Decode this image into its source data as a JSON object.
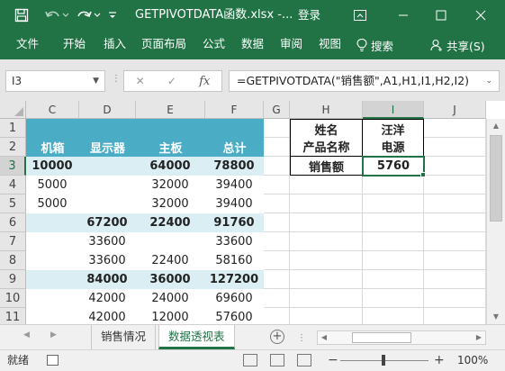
{
  "window": {
    "title": "GETPIVOTDATA函数.xlsx  -...",
    "login": "登录",
    "theme_color": "#217346"
  },
  "ribbon": {
    "tabs": [
      "文件",
      "开始",
      "插入",
      "页面布局",
      "公式",
      "数据",
      "审阅",
      "视图"
    ],
    "search": "搜索",
    "share": "共享(S)"
  },
  "formula_bar": {
    "name_box": "I3",
    "formula": "=GETPIVOTDATA(\"销售额\",A1,H1,I1,H2,I2)"
  },
  "columns": [
    "C",
    "D",
    "E",
    "F",
    "G",
    "H",
    "I",
    "J"
  ],
  "active_column": "I",
  "rows": [
    "1",
    "2",
    "3",
    "4",
    "5",
    "6",
    "7",
    "8",
    "9",
    "10"
  ],
  "active_row": "3",
  "pivot": {
    "header_row": [
      "机箱",
      "显示器",
      "主板",
      "总计"
    ],
    "header_color": "#4bacc6",
    "subtotal_color": "#daeef3",
    "data": [
      {
        "row": "3",
        "subtotal": true,
        "values": [
          "10000",
          "",
          "64000",
          "78800"
        ]
      },
      {
        "row": "4",
        "subtotal": false,
        "values": [
          "5000",
          "",
          "32000",
          "39400"
        ]
      },
      {
        "row": "5",
        "subtotal": false,
        "values": [
          "5000",
          "",
          "32000",
          "39400"
        ]
      },
      {
        "row": "6",
        "subtotal": true,
        "values": [
          "",
          "67200",
          "22400",
          "91760"
        ]
      },
      {
        "row": "7",
        "subtotal": false,
        "values": [
          "",
          "33600",
          "",
          "33600"
        ]
      },
      {
        "row": "8",
        "subtotal": false,
        "values": [
          "",
          "33600",
          "22400",
          "58160"
        ]
      },
      {
        "row": "9",
        "subtotal": true,
        "values": [
          "",
          "84000",
          "36000",
          "127200"
        ]
      },
      {
        "row": "10",
        "subtotal": false,
        "values": [
          "",
          "42000",
          "24000",
          "69600"
        ]
      },
      {
        "row": "11",
        "subtotal": false,
        "values": [
          "",
          "42000",
          "12000",
          "57600"
        ]
      }
    ]
  },
  "lookup_table": {
    "H1": "姓名",
    "I1": "汪洋",
    "H2": "产品名称",
    "I2": "电源",
    "H3": "销售额",
    "I3": "5760"
  },
  "sheets": {
    "tabs": [
      "销售情况",
      "数据透视表"
    ],
    "active": "数据透视表"
  },
  "status": {
    "ready": "就绪",
    "zoom": "100%"
  }
}
